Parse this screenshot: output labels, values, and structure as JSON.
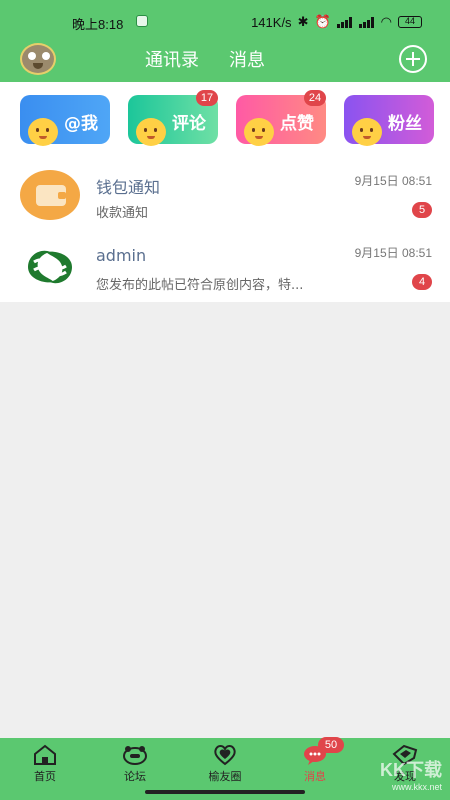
{
  "status_bar": {
    "time": "晚上8:18",
    "network_speed": "141K/s",
    "battery": "44"
  },
  "header": {
    "tabs": [
      "通讯录",
      "消息"
    ],
    "avatar_icon": "tom-cat-avatar",
    "add_icon": "plus-circle-icon"
  },
  "quick_actions": [
    {
      "label": "@我",
      "badge": ""
    },
    {
      "label": "评论",
      "badge": "17"
    },
    {
      "label": "点赞",
      "badge": "24"
    },
    {
      "label": "粉丝",
      "badge": ""
    }
  ],
  "messages": [
    {
      "title": "钱包通知",
      "subtitle": "收款通知",
      "time": "9月15日 08:51",
      "count": "5",
      "icon": "wallet-icon"
    },
    {
      "title": "admin",
      "subtitle": "您发布的此帖已符合原创内容，特...",
      "time": "9月15日 08:51",
      "count": "4",
      "icon": "admin-logo-icon"
    }
  ],
  "bottom_nav": [
    {
      "label": "首页",
      "icon": "home-icon"
    },
    {
      "label": "论坛",
      "icon": "forum-icon"
    },
    {
      "label": "榆友圈",
      "icon": "heart-icon"
    },
    {
      "label": "消息",
      "icon": "message-icon",
      "badge": "50",
      "active": true
    },
    {
      "label": "发现",
      "icon": "discover-icon"
    }
  ],
  "watermark": {
    "brand": "KK下载",
    "url": "www.kkx.net"
  },
  "colors": {
    "primary": "#5bc870",
    "badge": "#e0454a"
  }
}
